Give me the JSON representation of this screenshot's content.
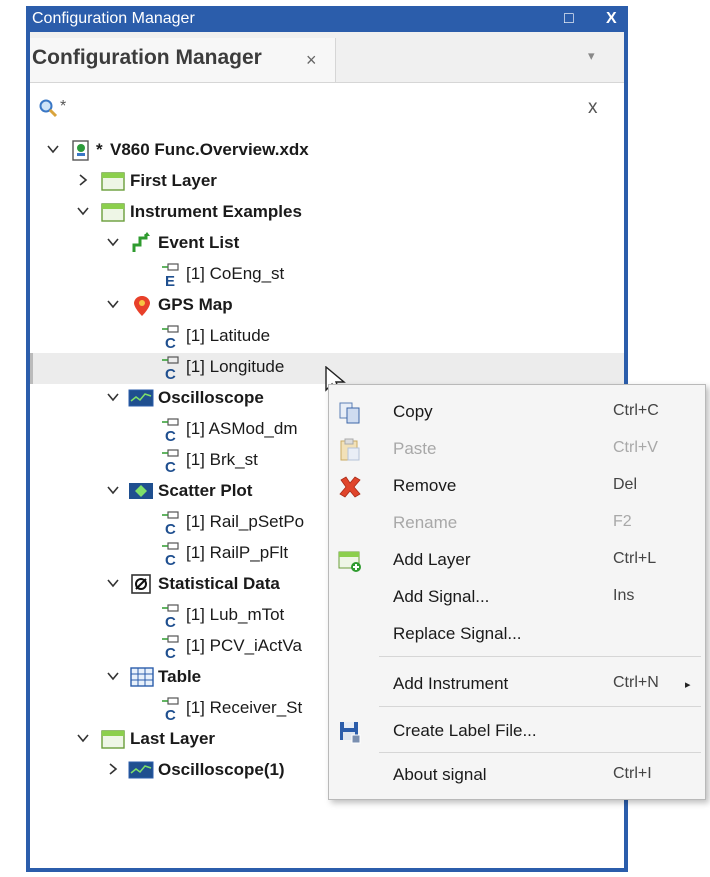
{
  "window": {
    "title": "Configuration Manager",
    "restore_glyph": "□",
    "close_glyph": "X"
  },
  "tab": {
    "label": "Configuration Manager",
    "close_glyph": "×",
    "menu_glyph": "▾"
  },
  "filter": {
    "value": "*",
    "clear_glyph": "x"
  },
  "tree": {
    "root": {
      "prefix": "* ",
      "label": "V860 Func.Overview.xdx"
    },
    "first_layer": "First Layer",
    "instrument_examples": "Instrument Examples",
    "event_list": "Event List",
    "coeng": "[1] CoEng_st",
    "gps_map": "GPS Map",
    "latitude": "[1] Latitude",
    "longitude": "[1] Longitude",
    "oscilloscope": "Oscilloscope",
    "asmod": "[1] ASMod_dm",
    "brk": "[1] Brk_st",
    "scatter_plot": "Scatter Plot",
    "rail_pset": "[1] Rail_pSetPo",
    "railp_pflt": "[1] RailP_pFlt",
    "statistical_data": "Statistical Data",
    "lub_mtot": "[1] Lub_mTot",
    "pcv_iact": "[1] PCV_iActVa",
    "table": "Table",
    "receiver": "[1] Receiver_St",
    "last_layer": "Last Layer",
    "oscilloscope1": "Oscilloscope(1)"
  },
  "context_menu": {
    "items": [
      {
        "label": "Copy",
        "shortcut": "Ctrl+C",
        "icon": "copy-icon",
        "enabled": true
      },
      {
        "label": "Paste",
        "shortcut": "Ctrl+V",
        "icon": "paste-icon",
        "enabled": false
      },
      {
        "label": "Remove",
        "shortcut": "Del",
        "icon": "remove-icon",
        "enabled": true
      },
      {
        "label": "Rename",
        "shortcut": "F2",
        "icon": "",
        "enabled": false
      },
      {
        "label": "Add Layer",
        "shortcut": "Ctrl+L",
        "icon": "add-layer-icon",
        "enabled": true
      },
      {
        "label": "Add Signal...",
        "shortcut": "Ins",
        "icon": "",
        "enabled": true
      },
      {
        "label": "Replace Signal...",
        "shortcut": "",
        "icon": "",
        "enabled": true
      },
      {
        "label": "Add Instrument",
        "shortcut": "Ctrl+N",
        "icon": "",
        "enabled": true,
        "submenu": true
      },
      {
        "label": "Create Label File...",
        "shortcut": "",
        "icon": "save-icon",
        "enabled": true
      },
      {
        "label": "About signal",
        "shortcut": "Ctrl+I",
        "icon": "",
        "enabled": true
      }
    ],
    "submenu_glyph": "▸"
  },
  "colors": {
    "frame": "#2b5dab",
    "selection": "#ececec",
    "menu_bg": "#f5f5f5"
  }
}
